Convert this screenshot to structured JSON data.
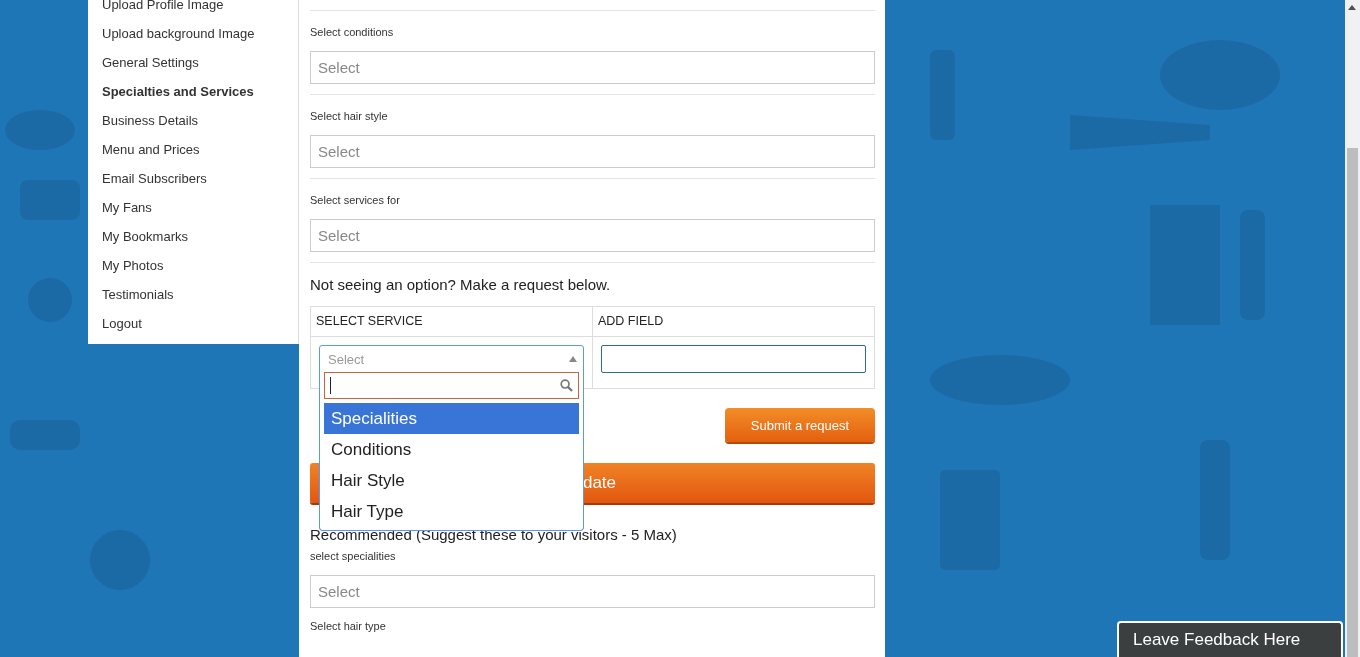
{
  "sidebar": {
    "items": [
      {
        "label": "Upload Profile Image",
        "selected": false
      },
      {
        "label": "Upload background Image",
        "selected": false
      },
      {
        "label": "General Settings",
        "selected": false
      },
      {
        "label": "Specialties and Services",
        "selected": true
      },
      {
        "label": "Business Details",
        "selected": false
      },
      {
        "label": "Menu and Prices",
        "selected": false
      },
      {
        "label": "Email Subscribers",
        "selected": false
      },
      {
        "label": "My Fans",
        "selected": false
      },
      {
        "label": "My Bookmarks",
        "selected": false
      },
      {
        "label": "My Photos",
        "selected": false
      },
      {
        "label": "Testimonials",
        "selected": false
      },
      {
        "label": "Logout",
        "selected": false
      }
    ]
  },
  "sections": [
    {
      "label": "Select conditions",
      "placeholder": "Select"
    },
    {
      "label": "Select hair style",
      "placeholder": "Select"
    },
    {
      "label": "Select services for",
      "placeholder": "Select"
    }
  ],
  "request": {
    "heading": "Not seeing an option? Make a request below.",
    "columns": [
      "SELECT SERVICE",
      "ADD FIELD"
    ],
    "service_select": {
      "placeholder": "Select",
      "expanded": true,
      "options": [
        {
          "label": "Specialities",
          "selected": true
        },
        {
          "label": "Conditions",
          "selected": false
        },
        {
          "label": "Hair Style",
          "selected": false
        },
        {
          "label": "Hair Type",
          "selected": false
        }
      ]
    },
    "submit_button": "Submit a request"
  },
  "update_button": "date",
  "recommended": {
    "heading": "Recommended (Suggest these to your visitors - 5 Max)",
    "sections": [
      {
        "label": "select specialities",
        "placeholder": "Select"
      },
      {
        "label": "Select hair type"
      }
    ]
  },
  "feedback_tab": "Leave Feedback Here"
}
